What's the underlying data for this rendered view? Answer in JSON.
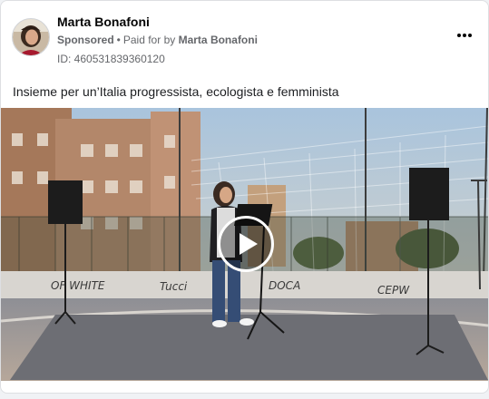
{
  "post": {
    "author": "Marta Bonafoni",
    "sponsored_label": "Sponsored",
    "separator": "•",
    "paid_for_prefix": "Paid for by",
    "paid_for_name": "Marta Bonafoni",
    "ad_id": "ID: 460531839360120",
    "caption": "Insieme per un’Italia progressista, ecologista e femminista",
    "more_icon": "ellipsis-icon",
    "play_icon": "play-icon"
  },
  "colors": {
    "card_bg": "#ffffff",
    "page_bg": "#f0f2f5",
    "secondary_text": "#65676b",
    "primary_text": "#050505"
  }
}
